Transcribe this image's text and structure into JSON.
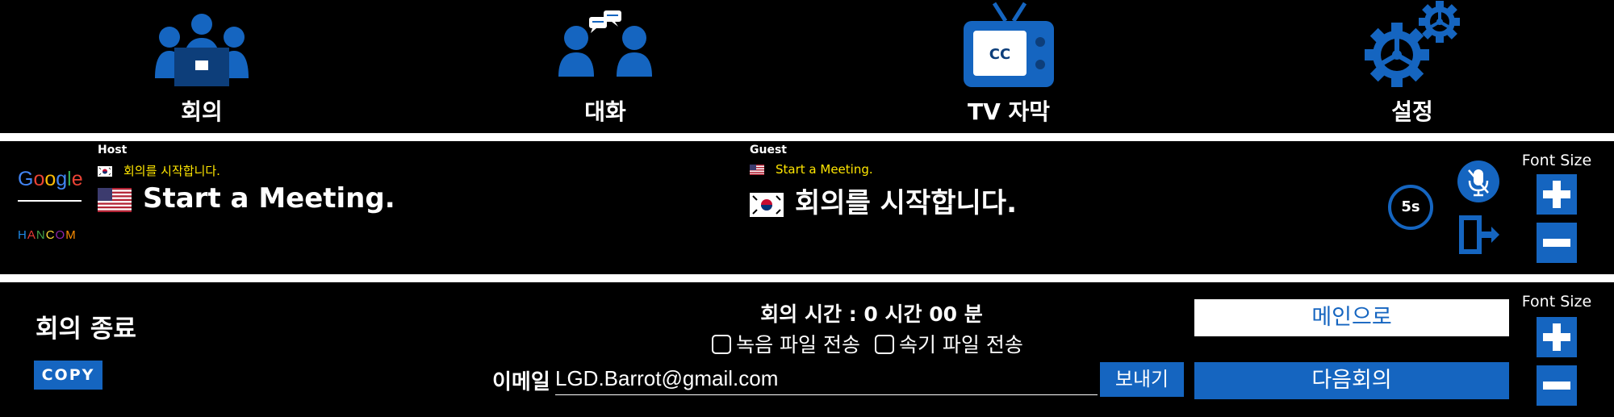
{
  "nav": {
    "items": [
      {
        "label": "회의",
        "icon": "meeting-people-icon"
      },
      {
        "label": "대화",
        "icon": "conversation-icon"
      },
      {
        "label": "TV 자막",
        "icon": "tv-cc-icon",
        "icon_text": "CC"
      },
      {
        "label": "설정",
        "icon": "settings-gears-icon"
      }
    ]
  },
  "captions": {
    "logos": {
      "google": "Google",
      "hancom": "HANCOM"
    },
    "host": {
      "label": "Host",
      "source_text": "회의를 시작합니다.",
      "source_flag": "kr-flag",
      "translated_text": "Start a Meeting.",
      "translated_flag": "us-flag"
    },
    "guest": {
      "label": "Guest",
      "source_text": "Start a Meeting.",
      "source_flag": "us-flag",
      "translated_text": "회의를 시작합니다.",
      "translated_flag": "kr-flag"
    },
    "timer": "5s",
    "font_size_label": "Font Size"
  },
  "bottom": {
    "end_title": "회의 종료",
    "copy_label": "COPY",
    "meeting_time": "회의 시간 : 0 시간 00 분",
    "checkbox_recording": "녹음 파일 전송",
    "checkbox_stenography": "속기 파일 전송",
    "email_label": "이메일",
    "email_value": "LGD.Barrot@gmail.com",
    "send_label": "보내기",
    "main_label": "메인으로",
    "next_label": "다음회의",
    "font_size_label": "Font Size"
  },
  "colors": {
    "accent": "#1565c0",
    "caption_small": "#ffe600",
    "background": "#000000"
  }
}
